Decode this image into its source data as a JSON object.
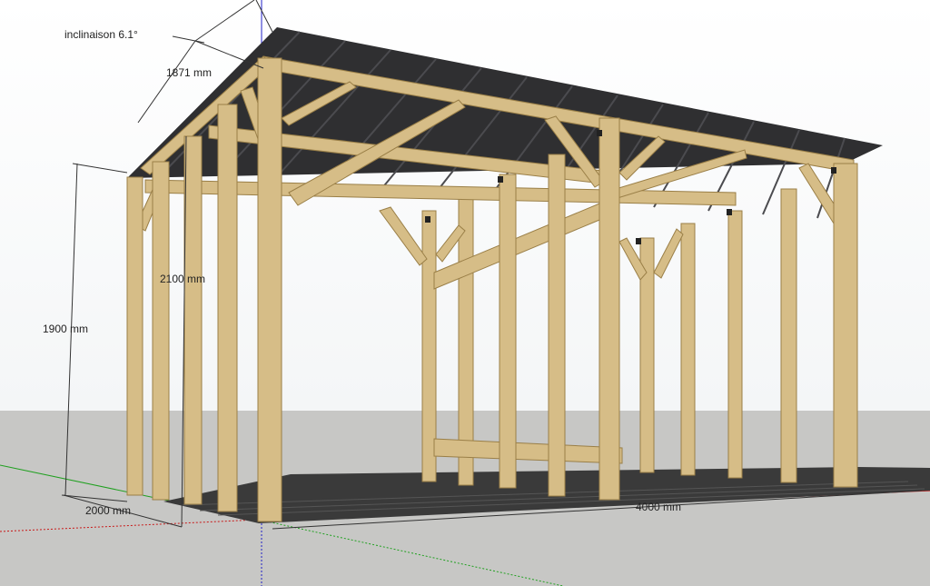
{
  "dimensions": {
    "slope": "inclinaison 6.1°",
    "rafter_length": "1871 mm",
    "height_front": "1900 mm",
    "height_back": "2100 mm",
    "depth": "2000 mm",
    "width": "4000 mm"
  },
  "colors": {
    "ground": "#c7c7c5",
    "sky": "#f4f6f7",
    "roof": "#2f2f31",
    "roof_ridge": "#4b4b4f",
    "wood": "#d6bd87",
    "wood_dark": "#9a7f47",
    "floor": "#3a3a3a",
    "axis_red": "#c81818",
    "axis_green": "#20a020",
    "axis_blue": "#2020c8"
  }
}
